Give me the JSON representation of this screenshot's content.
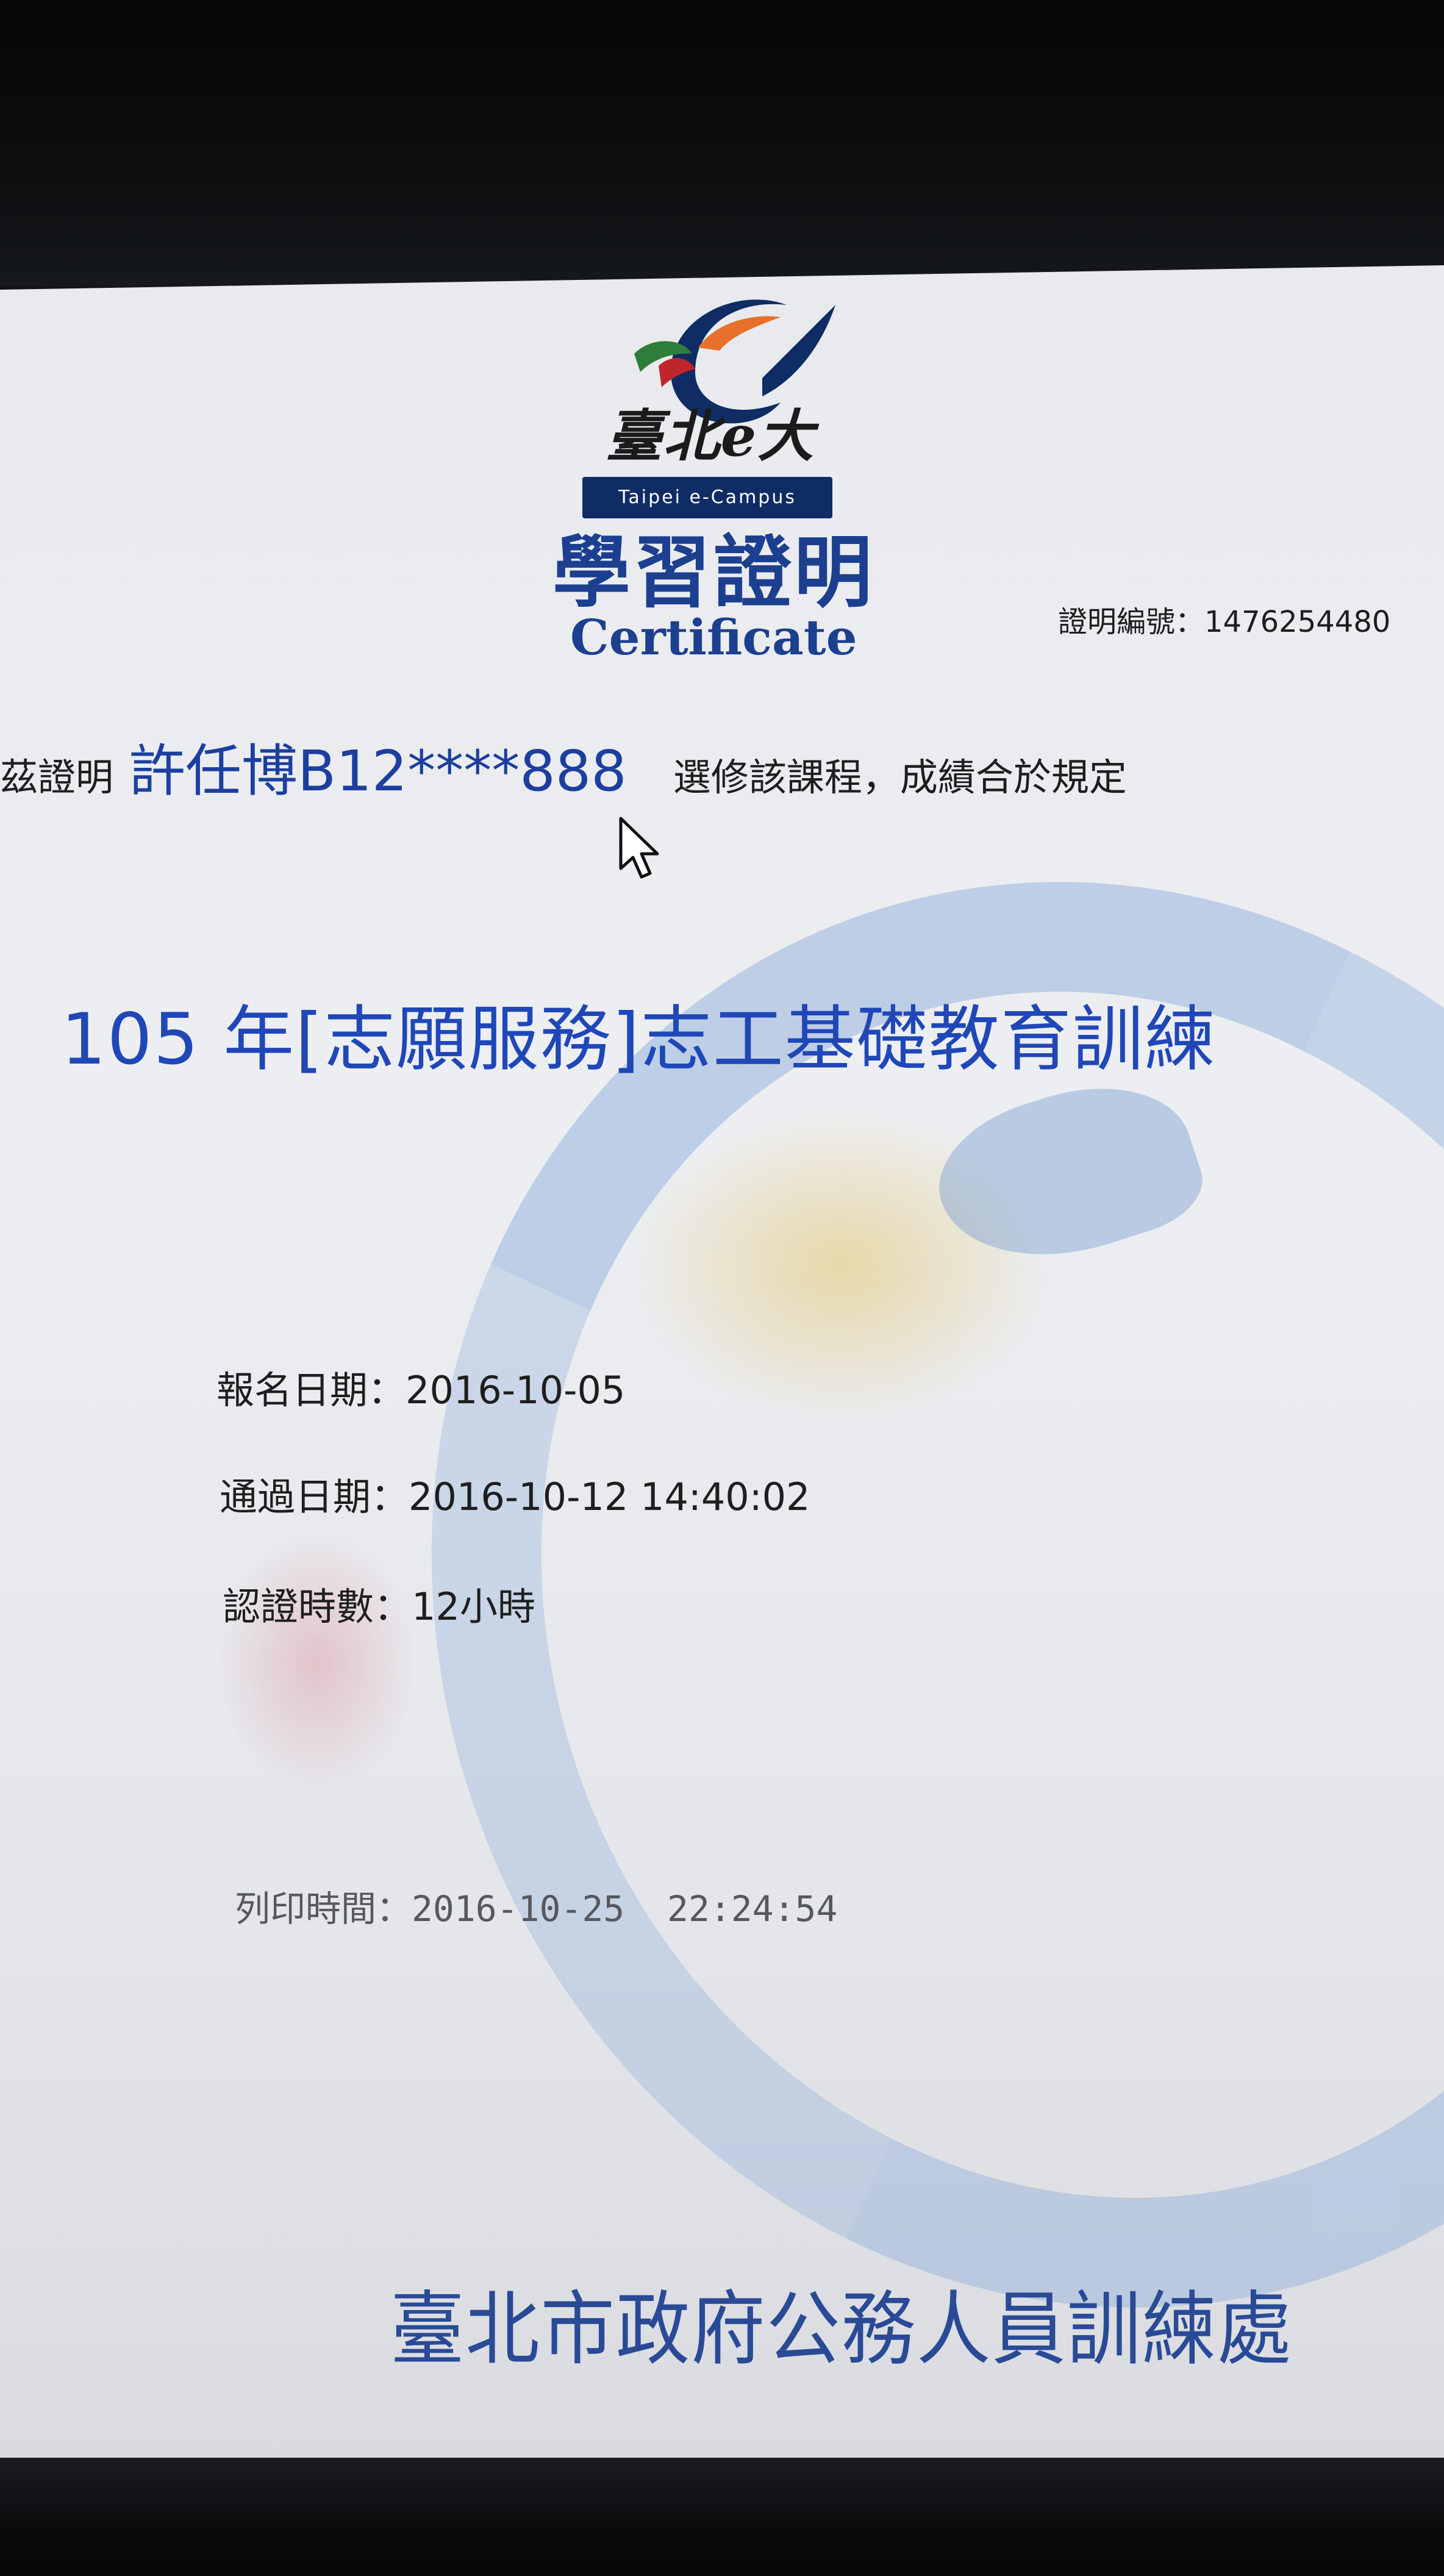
{
  "logo": {
    "script_text": "臺北e大",
    "bar_text": "Taipei e-Campus",
    "colors": {
      "navy": "#0f2c64",
      "orange": "#e8702a",
      "green": "#2e7d3a",
      "red": "#c0242c"
    }
  },
  "certificate": {
    "title_cn": "學習證明",
    "title_en": "Certificate",
    "number_label": "證明編號：",
    "number_value": "1476254480"
  },
  "statement": {
    "prefix": "茲證明",
    "name": "許任博B12****888",
    "suffix": "選修該課程，成績合於規定"
  },
  "course": {
    "title": "105 年[志願服務]志工基礎教育訓練"
  },
  "details": {
    "signup_label": "報名日期：",
    "signup_value": "2016-10-05",
    "pass_label": "通過日期：",
    "pass_value": "2016-10-12 14:40:02",
    "hours_label": "認證時數：",
    "hours_value": "12小時"
  },
  "print": {
    "label": "列印時間：",
    "value": "2016-10-25  22:24:54"
  },
  "issuer": {
    "name": "臺北市政府公務人員訓練處"
  },
  "cursor": {
    "icon": "mouse-pointer-icon"
  },
  "colors": {
    "accent_blue": "#1f47b8",
    "title_blue": "#1c3f8f",
    "text_dark": "#1e1e1e",
    "watermark_blue": "#78a0d7",
    "watermark_yellow": "#e6c86e"
  }
}
